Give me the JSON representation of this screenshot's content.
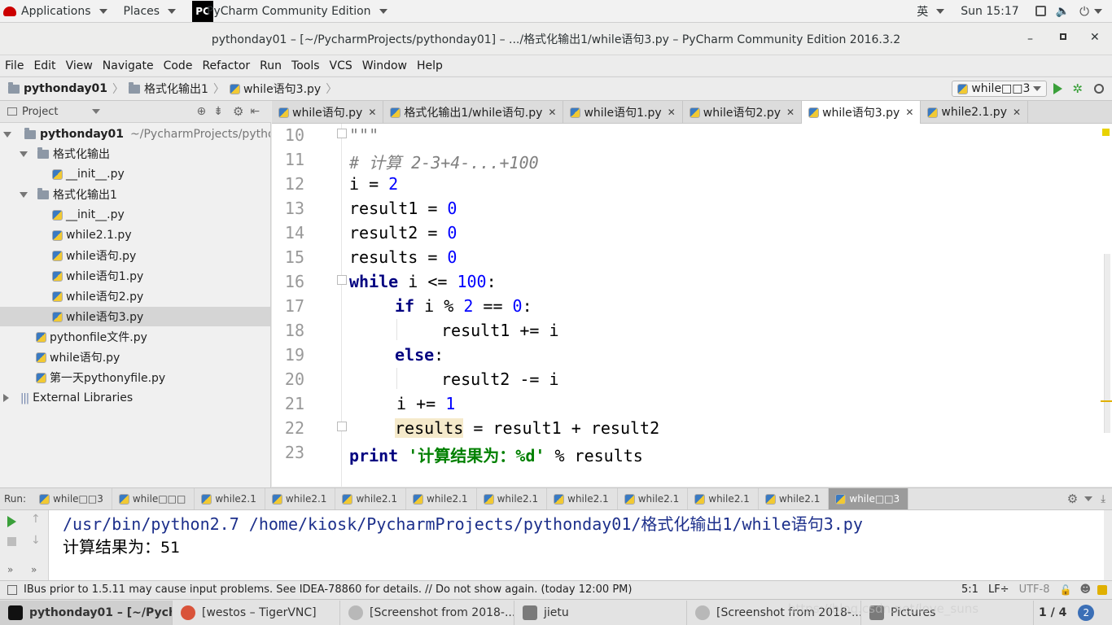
{
  "topbar": {
    "applications": "Applications",
    "places": "Places",
    "active_app": "PyCharm Community Edition",
    "input_method": "英",
    "clock": "Sun 15:17"
  },
  "window": {
    "title": "pythonday01 – [~/PycharmProjects/pythonday01] – .../格式化输出1/while语句3.py – PyCharm Community Edition 2016.3.2"
  },
  "menu": [
    "File",
    "Edit",
    "View",
    "Navigate",
    "Code",
    "Refactor",
    "Run",
    "Tools",
    "VCS",
    "Window",
    "Help"
  ],
  "breadcrumb": [
    "pythonday01",
    "格式化输出1",
    "while语句3.py"
  ],
  "run_config": "while□□3",
  "project_panel": {
    "title": "Project",
    "root": "pythonday01",
    "root_path": "~/PycharmProjects/pythonday",
    "folder1": "格式化输出",
    "folder1_files": [
      "__init__.py"
    ],
    "folder2": "格式化输出1",
    "folder2_files": [
      "__init__.py",
      "while2.1.py",
      "while语句.py",
      "while语句1.py",
      "while语句2.py",
      "while语句3.py"
    ],
    "root_files": [
      "pythonfile文件.py",
      "while语句.py",
      "第一天pythonyfile.py"
    ],
    "external": "External Libraries"
  },
  "editor_tabs": [
    "while语句.py",
    "格式化输出1/while语句.py",
    "while语句1.py",
    "while语句2.py",
    "while语句3.py",
    "while2.1.py"
  ],
  "editor": {
    "line_numbers": [
      "10",
      "11",
      "12",
      "13",
      "14",
      "15",
      "16",
      "17",
      "18",
      "19",
      "20",
      "21",
      "22",
      "23"
    ],
    "l10": "\"\"\"",
    "l11": "# 计算 2-3+4-...+100",
    "l12_a": "i = ",
    "l12_b": "2",
    "l13_a": "result1 = ",
    "l13_b": "0",
    "l14_a": "result2 = ",
    "l14_b": "0",
    "l15_a": "results = ",
    "l15_b": "0",
    "l16_a": "while",
    "l16_b": " i <= ",
    "l16_c": "100",
    "l16_d": ":",
    "l17_a": "if",
    "l17_b": " i % ",
    "l17_c": "2",
    "l17_d": " == ",
    "l17_e": "0",
    "l17_f": ":",
    "l18": "result1 += i",
    "l19": "else",
    "l19_b": ":",
    "l20": "result2 -= i",
    "l21_a": "i += ",
    "l21_b": "1",
    "l22_a": "results",
    "l22_b": " = result1 + result2",
    "l23_a": "print",
    "l23_b": " '计算结果为：%d'",
    "l23_c": " % results"
  },
  "run": {
    "label": "Run:",
    "tabs": [
      "while□□3",
      "while□□□",
      "while2.1",
      "while2.1",
      "while2.1",
      "while2.1",
      "while2.1",
      "while2.1",
      "while2.1",
      "while2.1",
      "while2.1",
      "while□□3"
    ],
    "console_line1": "/usr/bin/python2.7 /home/kiosk/PycharmProjects/pythonday01/格式化输出1/while语句3.py",
    "console_line2_label": "计算结果为：",
    "console_line2_value": "51"
  },
  "status": {
    "message": "IBus prior to 1.5.11 may cause input problems. See IDEA-78860 for details. // Do not show again. (today 12:00 PM)",
    "position": "5:1",
    "line_sep": "LF÷",
    "encoding": "UTF-8"
  },
  "taskbar": {
    "tasks": [
      "pythonday01 – [~/Pycha...",
      "[westos – TigerVNC]",
      "[Screenshot from 2018-...",
      "jietu",
      "[Screenshot from 2018-...",
      "Pictures"
    ],
    "watermark": "https://blog.csdn.net/love_suns",
    "pager": "1 / 4"
  },
  "colors": {
    "keyword": "#000080",
    "number": "#0000ff",
    "string": "#008000",
    "comment": "#808080",
    "run_green": "#3aa03a"
  }
}
